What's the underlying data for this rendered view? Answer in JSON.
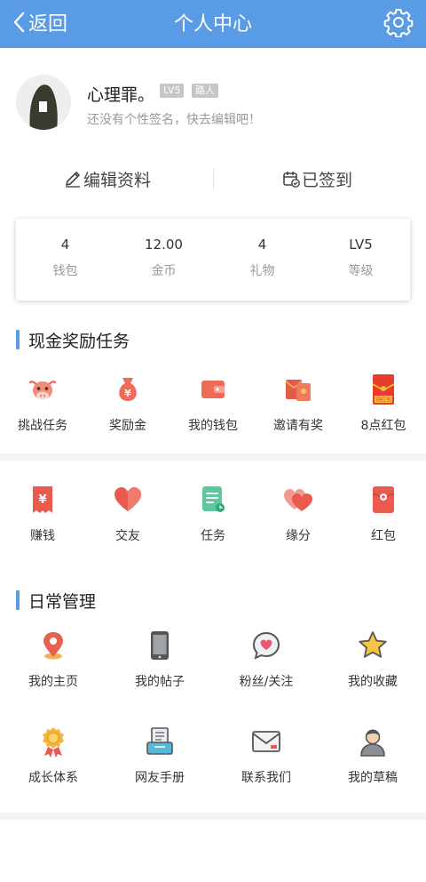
{
  "header": {
    "back_label": "返回",
    "title": "个人中心"
  },
  "profile": {
    "nickname": "心理罪。",
    "level_tag": "LV5",
    "role_tag": "路人",
    "signature": "还没有个性签名，快去编辑吧！"
  },
  "actions": {
    "edit": "编辑资料",
    "signin": "已签到"
  },
  "stats": [
    {
      "value": "4",
      "label": "钱包"
    },
    {
      "value": "12.00",
      "label": "金币"
    },
    {
      "value": "4",
      "label": "礼物"
    },
    {
      "value": "LV5",
      "label": "等级"
    }
  ],
  "sections": {
    "cash": "现金奖励任务",
    "daily": "日常管理"
  },
  "cash_tasks": [
    {
      "label": "挑战任务",
      "icon": "cow-icon"
    },
    {
      "label": "奖励金",
      "icon": "money-bag-icon"
    },
    {
      "label": "我的钱包",
      "icon": "wallet-icon"
    },
    {
      "label": "邀请有奖",
      "icon": "red-envelopes-icon"
    },
    {
      "label": "8点红包",
      "icon": "red-packet-icon",
      "badge": "领红包"
    }
  ],
  "features": [
    {
      "label": "赚钱",
      "icon": "yuan-receipt-icon"
    },
    {
      "label": "交友",
      "icon": "heart-icon"
    },
    {
      "label": "任务",
      "icon": "task-list-icon"
    },
    {
      "label": "缘分",
      "icon": "double-heart-icon"
    },
    {
      "label": "红包",
      "icon": "red-packet-icon"
    }
  ],
  "daily_row1": [
    {
      "label": "我的主页",
      "icon": "location-pin-icon"
    },
    {
      "label": "我的帖子",
      "icon": "phone-icon"
    },
    {
      "label": "粉丝/关注",
      "icon": "heart-bubble-icon"
    },
    {
      "label": "我的收藏",
      "icon": "star-icon"
    }
  ],
  "daily_row2": [
    {
      "label": "成长体系",
      "icon": "medal-icon"
    },
    {
      "label": "网友手册",
      "icon": "manual-icon"
    },
    {
      "label": "联系我们",
      "icon": "mail-icon"
    },
    {
      "label": "我的草稿",
      "icon": "person-icon"
    }
  ],
  "colors": {
    "header_bg": "#5a9be6",
    "accent": "#5a9be6",
    "icon_red": "#ea5a4e"
  }
}
